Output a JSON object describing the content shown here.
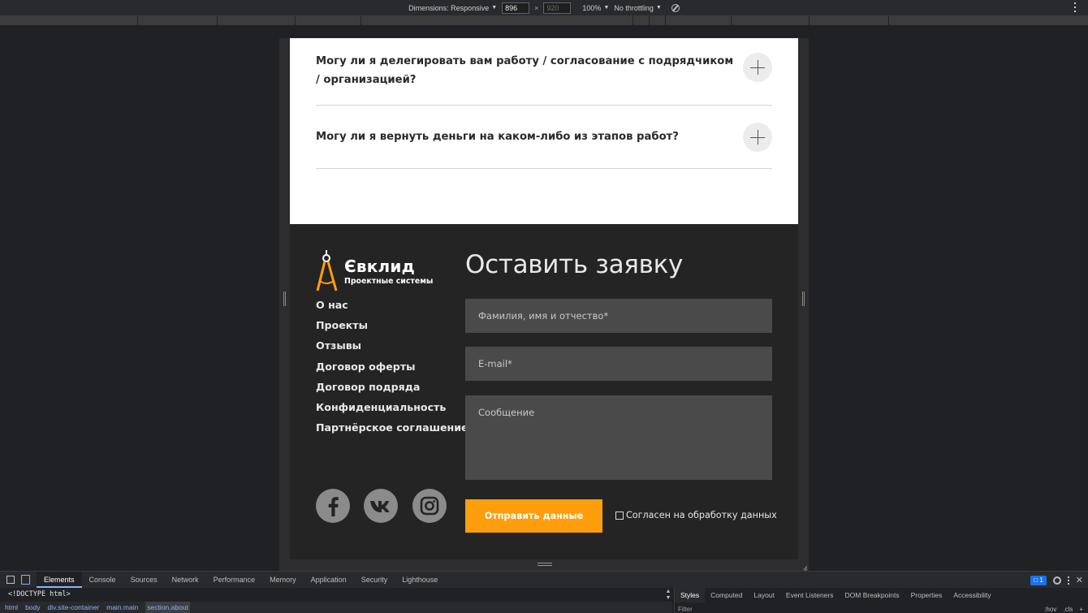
{
  "device_toolbar": {
    "dimensions_label": "Dimensions: Responsive",
    "width_value": "896",
    "height_value": "920",
    "times": "×",
    "zoom": "100%",
    "throttling": "No throttling"
  },
  "faq": {
    "items": [
      {
        "question": "Могу ли я делегировать вам работу / согласование с подрядчиком / организацией?"
      },
      {
        "question": "Могу ли я вернуть деньги на каком-либо из этапов работ?"
      }
    ]
  },
  "footer": {
    "logo": {
      "name": "Євклид",
      "tagline": "Проектные системы"
    },
    "nav": [
      "О нас",
      "Проекты",
      "Отзывы",
      "Договор оферты",
      "Договор подряда",
      "Конфиденциальность",
      "Партнёрское соглашение"
    ],
    "social": [
      "facebook-icon",
      "vk-icon",
      "instagram-icon"
    ],
    "form": {
      "title": "Оставить заявку",
      "name_placeholder": "Фамилия, имя и отчество*",
      "email_placeholder": "E-mail*",
      "message_placeholder": "Сообщение",
      "submit_label": "Отправить данные",
      "consent_label": "Согласен на обработку данных"
    },
    "colors": {
      "background": "#242424",
      "accent": "#ff9e0c",
      "field": "#4a4a4a",
      "social": "#8b8b8b"
    }
  },
  "devtools": {
    "tabs": [
      "Elements",
      "Console",
      "Sources",
      "Network",
      "Performance",
      "Memory",
      "Application",
      "Security",
      "Lighthouse"
    ],
    "issues_count": "1",
    "doctype": "<!DOCTYPE html>",
    "breadcrumbs": [
      "html",
      "body",
      "div.site-container",
      "main.main",
      "section.about"
    ],
    "side_tabs": [
      "Styles",
      "Computed",
      "Layout",
      "Event Listeners",
      "DOM Breakpoints",
      "Properties",
      "Accessibility"
    ],
    "filter_label": "Filter",
    "hov_label": ":hov",
    "cls_label": ".cls"
  }
}
